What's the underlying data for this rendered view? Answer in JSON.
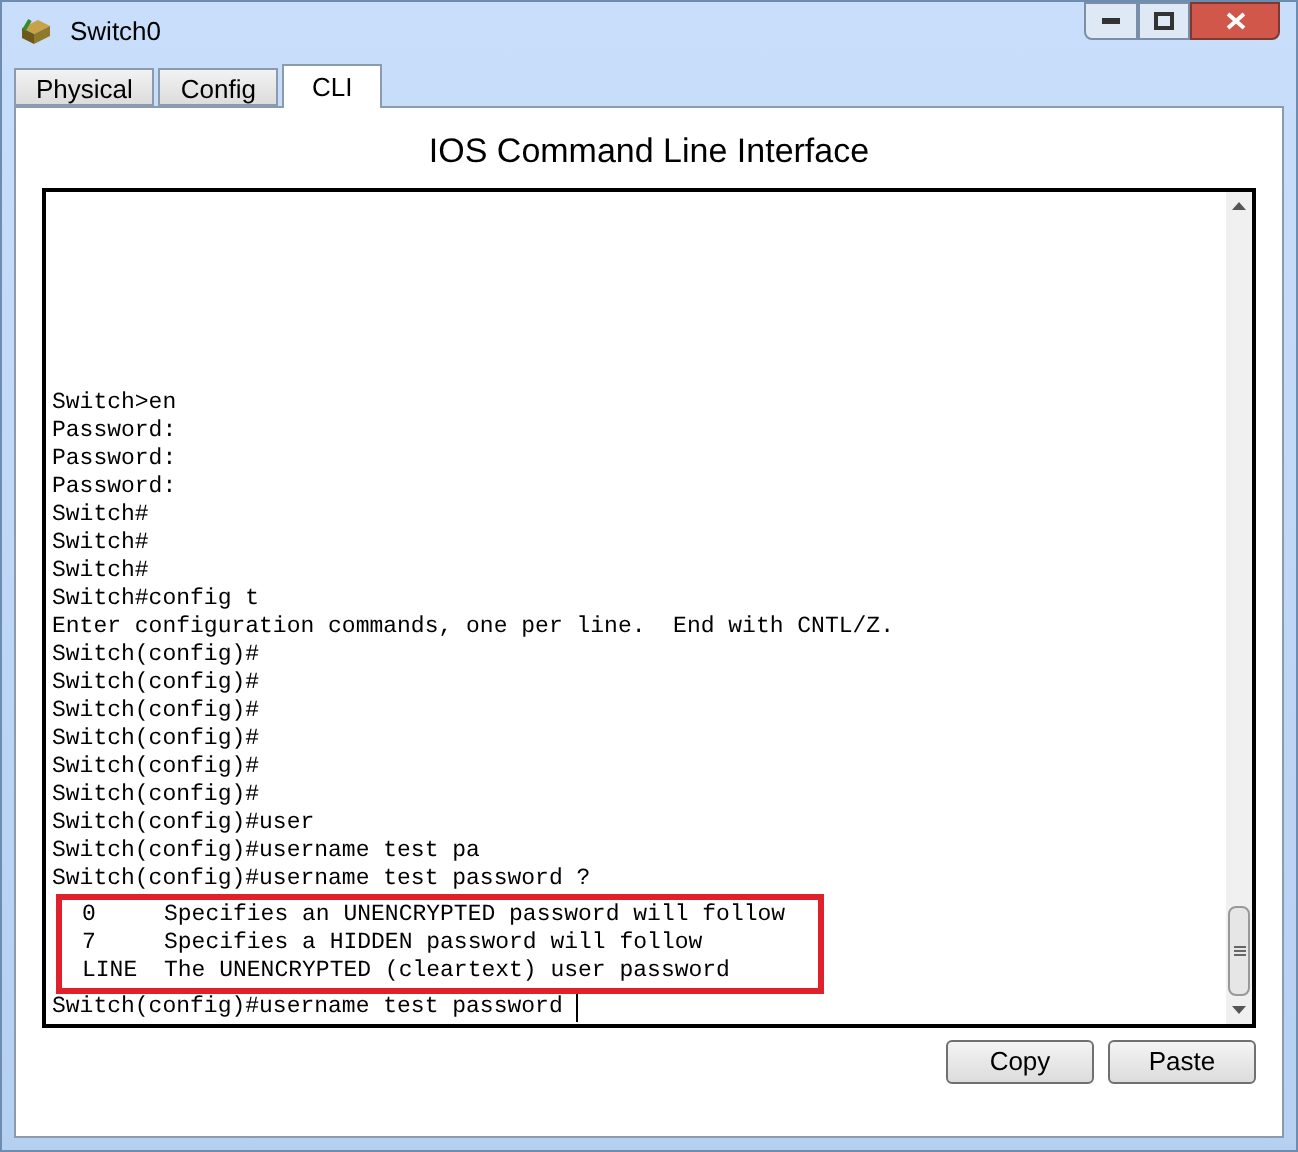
{
  "window": {
    "title": "Switch0"
  },
  "tabs": [
    {
      "label": "Physical",
      "selected": false
    },
    {
      "label": "Config",
      "selected": false
    },
    {
      "label": "CLI",
      "selected": true
    }
  ],
  "heading": "IOS Command Line Interface",
  "terminal": {
    "lines": [
      "Switch>en",
      "Password:",
      "Password:",
      "Password:",
      "Switch#",
      "Switch#",
      "Switch#",
      "Switch#config t",
      "Enter configuration commands, one per line.  End with CNTL/Z.",
      "Switch(config)#",
      "Switch(config)#",
      "Switch(config)#",
      "Switch(config)#",
      "Switch(config)#",
      "Switch(config)#",
      "Switch(config)#user",
      "Switch(config)#username test pa",
      "Switch(config)#username test password ?"
    ],
    "help": {
      "highlighted": true,
      "rows": [
        {
          "option": "0",
          "description": "Specifies an UNENCRYPTED password will follow"
        },
        {
          "option": "7",
          "description": "Specifies a HIDDEN password will follow"
        },
        {
          "option": "LINE",
          "description": "The UNENCRYPTED (cleartext) user password"
        }
      ]
    },
    "prompt": "Switch(config)#username test password "
  },
  "buttons": [
    "Copy",
    "Paste"
  ]
}
